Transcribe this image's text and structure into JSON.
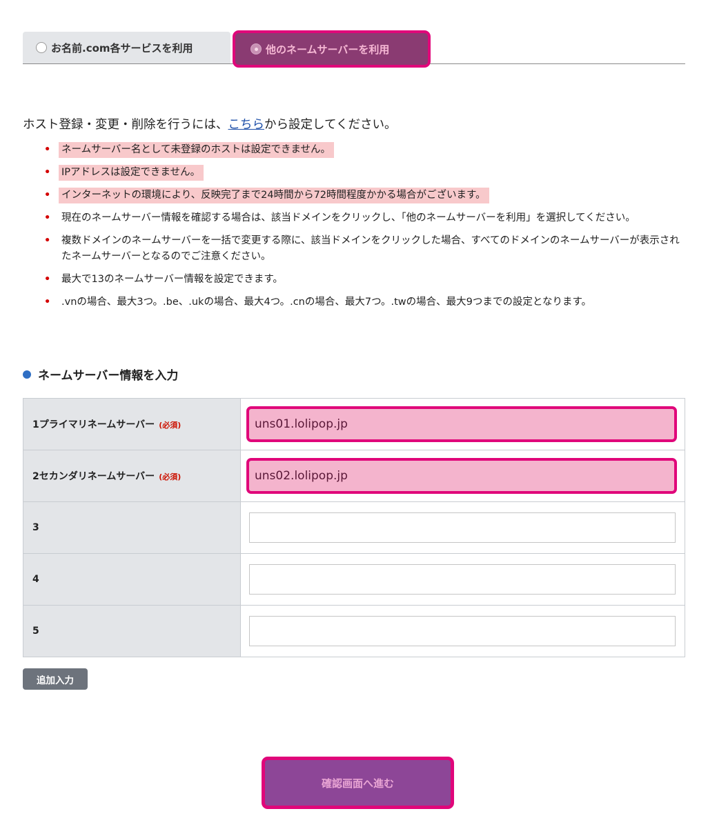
{
  "tabs": [
    {
      "label": "お名前.com各サービスを利用",
      "selected": false
    },
    {
      "label": "他のネームサーバーを利用",
      "selected": true
    }
  ],
  "intro": {
    "before": "ホスト登録・変更・削除を行うには、",
    "link": "こちら",
    "after": "から設定してください。"
  },
  "notes": [
    "ネームサーバー名として未登録のホストは設定できません。",
    "IPアドレスは設定できません。",
    "インターネットの環境により、反映完了まで24時間から72時間程度かかる場合がございます。",
    "現在のネームサーバー情報を確認する場合は、該当ドメインをクリックし、「他のネームサーバーを利用」を選択してください。",
    "複数ドメインのネームサーバーを一括で変更する際に、該当ドメインをクリックした場合、すべてのドメインのネームサーバーが表示されたネームサーバーとなるのでご注意ください。",
    "最大で13のネームサーバー情報を設定できます。",
    ".vnの場合、最大3つ。.be、.ukの場合、最大4つ。.cnの場合、最大7つ。.twの場合、最大9つまでの設定となります。"
  ],
  "section_title": "ネームサーバー情報を入力",
  "rows": [
    {
      "label": "1プライマリネームサーバー",
      "required": "(必須)",
      "value": "uns01.lolipop.jp"
    },
    {
      "label": "2セカンダリネームサーバー",
      "required": "(必須)",
      "value": "uns02.lolipop.jp"
    },
    {
      "label": "3",
      "value": ""
    },
    {
      "label": "4",
      "value": ""
    },
    {
      "label": "5",
      "value": ""
    }
  ],
  "add_button": "追加入力",
  "confirm_button": "確認画面へ進む",
  "colors": {
    "highlight_border": "#e0067a",
    "active_tab_bg": "#8a3b72",
    "confirm_bg": "#8d4697",
    "required_text": "#cc1100",
    "link": "#1d4fa8"
  }
}
